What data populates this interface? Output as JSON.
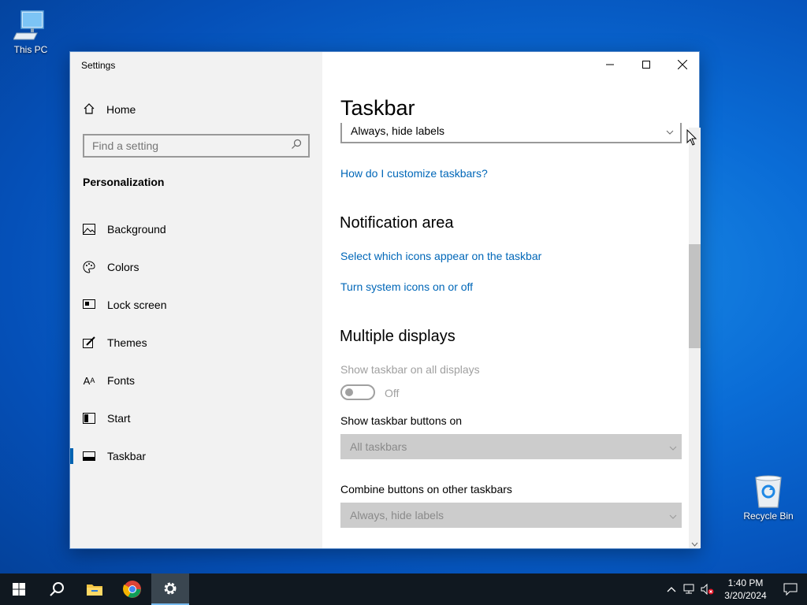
{
  "desktop": {
    "icons": [
      {
        "label": "This PC"
      },
      {
        "label": "Recycle Bin"
      }
    ]
  },
  "window": {
    "title": "Settings",
    "sidebar": {
      "home_label": "Home",
      "search_placeholder": "Find a setting",
      "section": "Personalization",
      "items": [
        {
          "label": "Background",
          "icon": "picture-icon"
        },
        {
          "label": "Colors",
          "icon": "palette-icon"
        },
        {
          "label": "Lock screen",
          "icon": "monitor-icon"
        },
        {
          "label": "Themes",
          "icon": "brush-icon"
        },
        {
          "label": "Fonts",
          "icon": "font-icon"
        },
        {
          "label": "Start",
          "icon": "start-tiles-icon"
        },
        {
          "label": "Taskbar",
          "icon": "taskbar-icon",
          "active": true
        }
      ]
    },
    "content": {
      "title": "Taskbar",
      "top_dropdown_value": "Always, hide labels",
      "customize_link": "How do I customize taskbars?",
      "notification_area": {
        "heading": "Notification area",
        "link1": "Select which icons appear on the taskbar",
        "link2": "Turn system icons on or off"
      },
      "multiple_displays": {
        "heading": "Multiple displays",
        "show_all_label": "Show taskbar on all displays",
        "toggle_state": "Off",
        "buttons_on_label": "Show taskbar buttons on",
        "buttons_on_value": "All taskbars",
        "combine_label": "Combine buttons on other taskbars",
        "combine_value": "Always, hide labels"
      }
    }
  },
  "taskbar": {
    "time": "1:40 PM",
    "date": "3/20/2024"
  },
  "colors": {
    "accent": "#0063b1",
    "link": "#0067b8",
    "taskbar": "#101820"
  }
}
